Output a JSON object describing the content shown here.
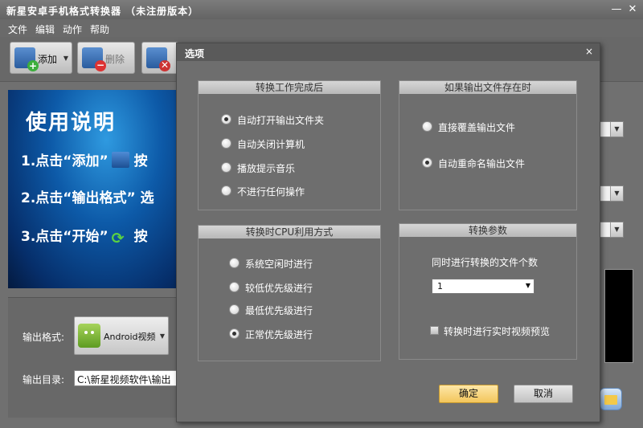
{
  "app": {
    "title": "新星安卓手机格式转换器 （未注册版本）"
  },
  "window_controls": {
    "minimize": "—",
    "close": "✕"
  },
  "menu": [
    "文件",
    "编辑",
    "动作",
    "帮助"
  ],
  "toolbar": {
    "add_label": "添加",
    "delete_label": "删除"
  },
  "banner": {
    "title": "使用说明",
    "steps": [
      "1.点击“添加”",
      "2.点击“输出格式”",
      "3.点击“开始”"
    ],
    "steps_tail": [
      "按",
      "选",
      "按"
    ]
  },
  "output": {
    "format_label": "输出格式:",
    "format_value": "Android视频",
    "dir_label": "输出目录:",
    "dir_value": "C:\\新星视频软件\\输出"
  },
  "dialog": {
    "title": "选项",
    "close": "×",
    "after_convert": {
      "header": "转换工作完成后",
      "options": [
        "自动打开输出文件夹",
        "自动关闭计算机",
        "播放提示音乐",
        "不进行任何操作"
      ],
      "selected_index": 0
    },
    "if_exists": {
      "header": "如果输出文件存在时",
      "options": [
        "直接覆盖输出文件",
        "自动重命名输出文件"
      ],
      "selected_index": 1
    },
    "cpu": {
      "header": "转换时CPU利用方式",
      "options": [
        "系统空闲时进行",
        "较低优先级进行",
        "最低优先级进行",
        "正常优先级进行"
      ],
      "selected_index": 3
    },
    "params": {
      "header": "转换参数",
      "count_label": "同时进行转换的文件个数",
      "count_value": "1",
      "preview_label": "转换时进行实时视频预览",
      "preview_checked": false
    },
    "ok_label": "确定",
    "cancel_label": "取消"
  }
}
